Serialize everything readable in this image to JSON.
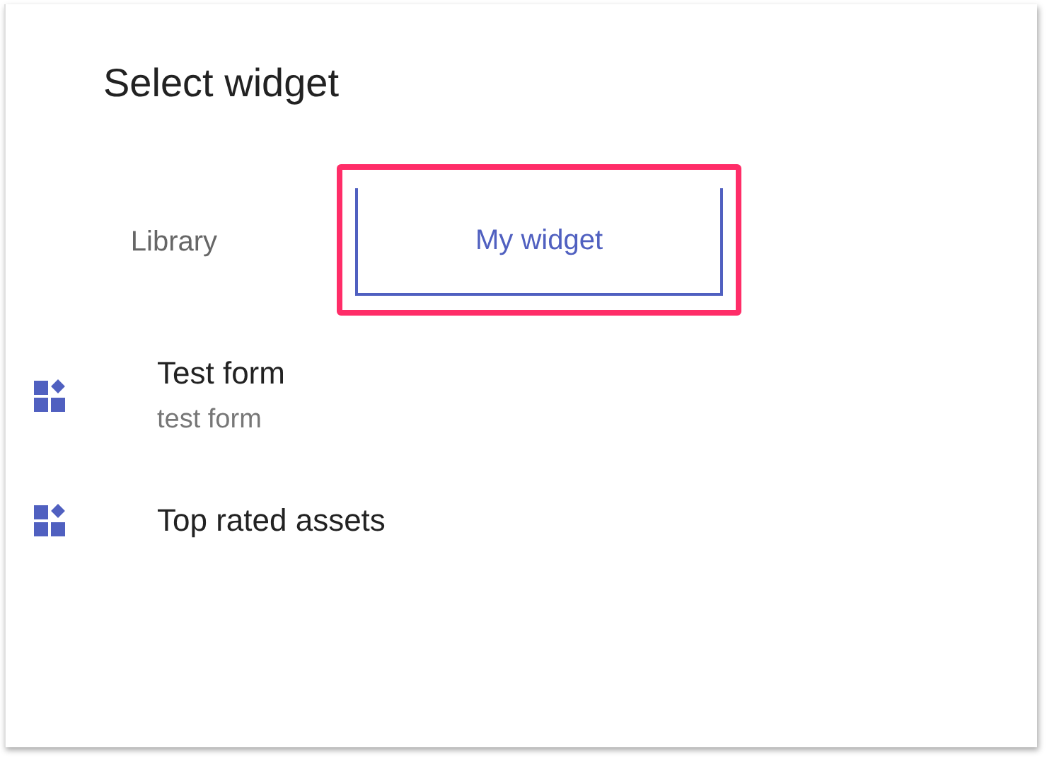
{
  "dialog": {
    "title": "Select widget"
  },
  "tabs": [
    {
      "label": "Library",
      "selected": false
    },
    {
      "label": "My widget",
      "selected": true,
      "highlighted": true
    }
  ],
  "widgets": [
    {
      "name": "Test form",
      "description": "test form"
    },
    {
      "name": "Top rated assets"
    }
  ]
}
